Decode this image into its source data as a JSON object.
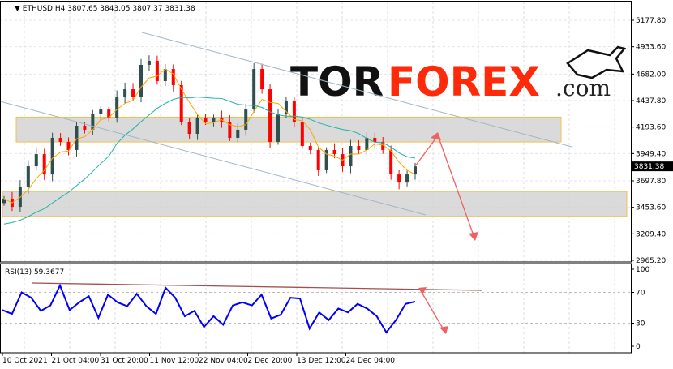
{
  "header": {
    "symbol": "ETHUSD,H4",
    "ohlc": "3807.65 3843.05 3807.37 3831.38"
  },
  "logo": {
    "part1": "TOR",
    "part2": "FOREX",
    "part3": ".com"
  },
  "rsi_label": "RSI(13) 59.3677",
  "chart_data": {
    "type": "candlestick",
    "title": "ETHUSD,H4",
    "price_ticks": [
      "5177.80",
      "4933.60",
      "4682.00",
      "4437.80",
      "4193.60",
      "3949.40",
      "3697.80",
      "3453.60",
      "3209.40",
      "2965.20"
    ],
    "ylim": [
      2965.2,
      5177.8
    ],
    "current_price": "3831.38",
    "x_ticks": [
      "10 Oct 2021",
      "21 Oct 04:00",
      "31 Oct 20:00",
      "11 Nov 12:00",
      "22 Nov 04:00",
      "2 Dec 20:00",
      "13 Dec 12:00",
      "24 Dec 04:00"
    ],
    "closes": [
      3533,
      3458,
      3645,
      3832,
      3944,
      3757,
      4094,
      4057,
      3982,
      4206,
      4169,
      4318,
      4355,
      4281,
      4468,
      4542,
      4468,
      4767,
      4804,
      4617,
      4729,
      4580,
      4243,
      4131,
      4281,
      4243,
      4281,
      4243,
      4094,
      4169,
      4355,
      4729,
      4542,
      4057,
      4318,
      4430,
      4243,
      4019,
      3982,
      3795,
      3982,
      3944,
      3832,
      4019,
      3982,
      4094,
      4057,
      3982,
      3757,
      3682,
      3757,
      3831
    ],
    "rsi": {
      "ticks": [
        "100",
        "70",
        "30",
        "0"
      ],
      "ylim": [
        0,
        100
      ],
      "levels": [
        70,
        30
      ],
      "values": [
        47,
        42,
        70,
        63,
        46,
        53,
        79,
        47,
        57,
        65,
        37,
        67,
        57,
        52,
        68,
        52,
        42,
        76,
        63,
        39,
        46,
        25,
        39,
        28,
        53,
        57,
        53,
        67,
        36,
        41,
        63,
        62,
        23,
        44,
        34,
        49,
        44,
        55,
        49,
        39,
        18,
        34,
        55,
        58
      ]
    },
    "colors": {
      "up": "#2f4f4f",
      "down": "#ff0000",
      "ma_fast": "#ffa500",
      "ma_slow": "#20b2aa",
      "rsi": "#0000ff",
      "arrow": "#f06060"
    }
  }
}
